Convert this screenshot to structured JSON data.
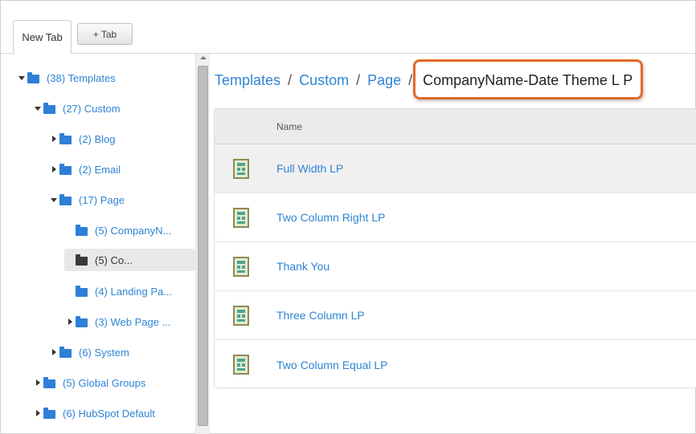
{
  "tabs": {
    "active_label": "New Tab",
    "add_label": "+ Tab"
  },
  "tree": [
    {
      "label": "(38) Templates",
      "caret": "down",
      "folder": "blue"
    },
    {
      "label": "(27) Custom",
      "caret": "down",
      "folder": "blue"
    },
    {
      "label": "(2) Blog",
      "caret": "right",
      "folder": "blue"
    },
    {
      "label": "(2) Email",
      "caret": "right",
      "folder": "blue"
    },
    {
      "label": "(17) Page",
      "caret": "down",
      "folder": "blue"
    },
    {
      "label": "(5) CompanyN...",
      "caret": "none",
      "folder": "blue"
    },
    {
      "label": "(5) Co...",
      "caret": "none",
      "folder": "dark",
      "selected": true
    },
    {
      "label": "(4) Landing Pa...",
      "caret": "none",
      "folder": "blue"
    },
    {
      "label": "(3) Web Page ...",
      "caret": "right",
      "folder": "blue"
    },
    {
      "label": "(6) System",
      "caret": "right",
      "folder": "blue"
    },
    {
      "label": "(5) Global Groups",
      "caret": "right",
      "folder": "blue"
    },
    {
      "label": "(6) HubSpot Default",
      "caret": "right",
      "folder": "blue"
    }
  ],
  "breadcrumb": {
    "items": [
      "Templates",
      "Custom",
      "Page"
    ],
    "separator": "/",
    "current": "CompanyName-Date Theme L P"
  },
  "table": {
    "column_name": "Name",
    "rows": [
      {
        "name": "Full Width LP",
        "icon": "page-template-icon"
      },
      {
        "name": "Two Column Right LP",
        "icon": "page-template-icon"
      },
      {
        "name": "Thank You",
        "icon": "page-template-icon"
      },
      {
        "name": "Three Column LP",
        "icon": "page-template-icon"
      },
      {
        "name": "Two Column Equal LP",
        "icon": "page-template-icon"
      }
    ]
  },
  "colors": {
    "link": "#2f84d4",
    "folder": "#2d7fd8",
    "highlight": "#e06b26"
  }
}
